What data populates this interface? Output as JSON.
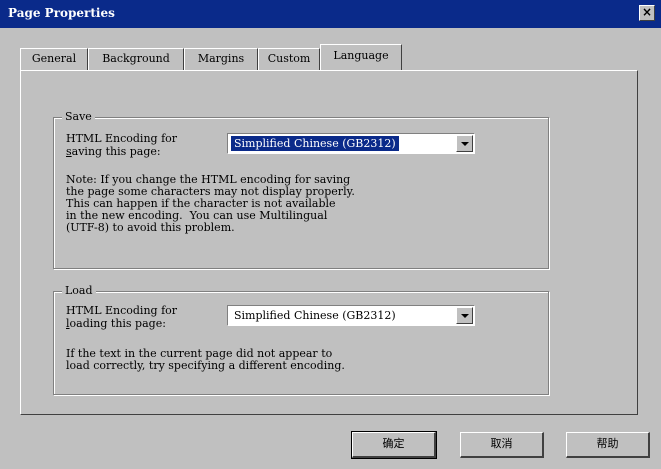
{
  "window": {
    "title": "Page Properties",
    "close_glyph": "×"
  },
  "tabs": [
    {
      "label": "General"
    },
    {
      "label": "Background"
    },
    {
      "label": "Margins"
    },
    {
      "label": "Custom"
    },
    {
      "label": "Language",
      "active": true
    }
  ],
  "save_group": {
    "legend": "Save",
    "label_line1": "HTML Encoding for",
    "label_line2": "saving this page:",
    "selected_encoding": "Simplified Chinese (GB2312)",
    "note": "Note: If you change the HTML encoding for saving\nthe page some characters may not display properly.\nThis can happen if the character is not available\nin the new encoding.  You can use Multilingual\n(UTF-8) to avoid this problem."
  },
  "load_group": {
    "legend": "Load",
    "label_line1": "HTML Encoding for",
    "label_line2": "loading this page:",
    "selected_encoding": "Simplified Chinese (GB2312)",
    "note": "If the text in the current page did not appear to\nload correctly, try specifying a different encoding."
  },
  "buttons": {
    "ok": "确定",
    "cancel": "取消",
    "help": "帮助"
  },
  "colors": {
    "title_bar": "#0a2a8a",
    "dialog_face": "#c0c0c0",
    "selection": "#0a2a8a"
  }
}
